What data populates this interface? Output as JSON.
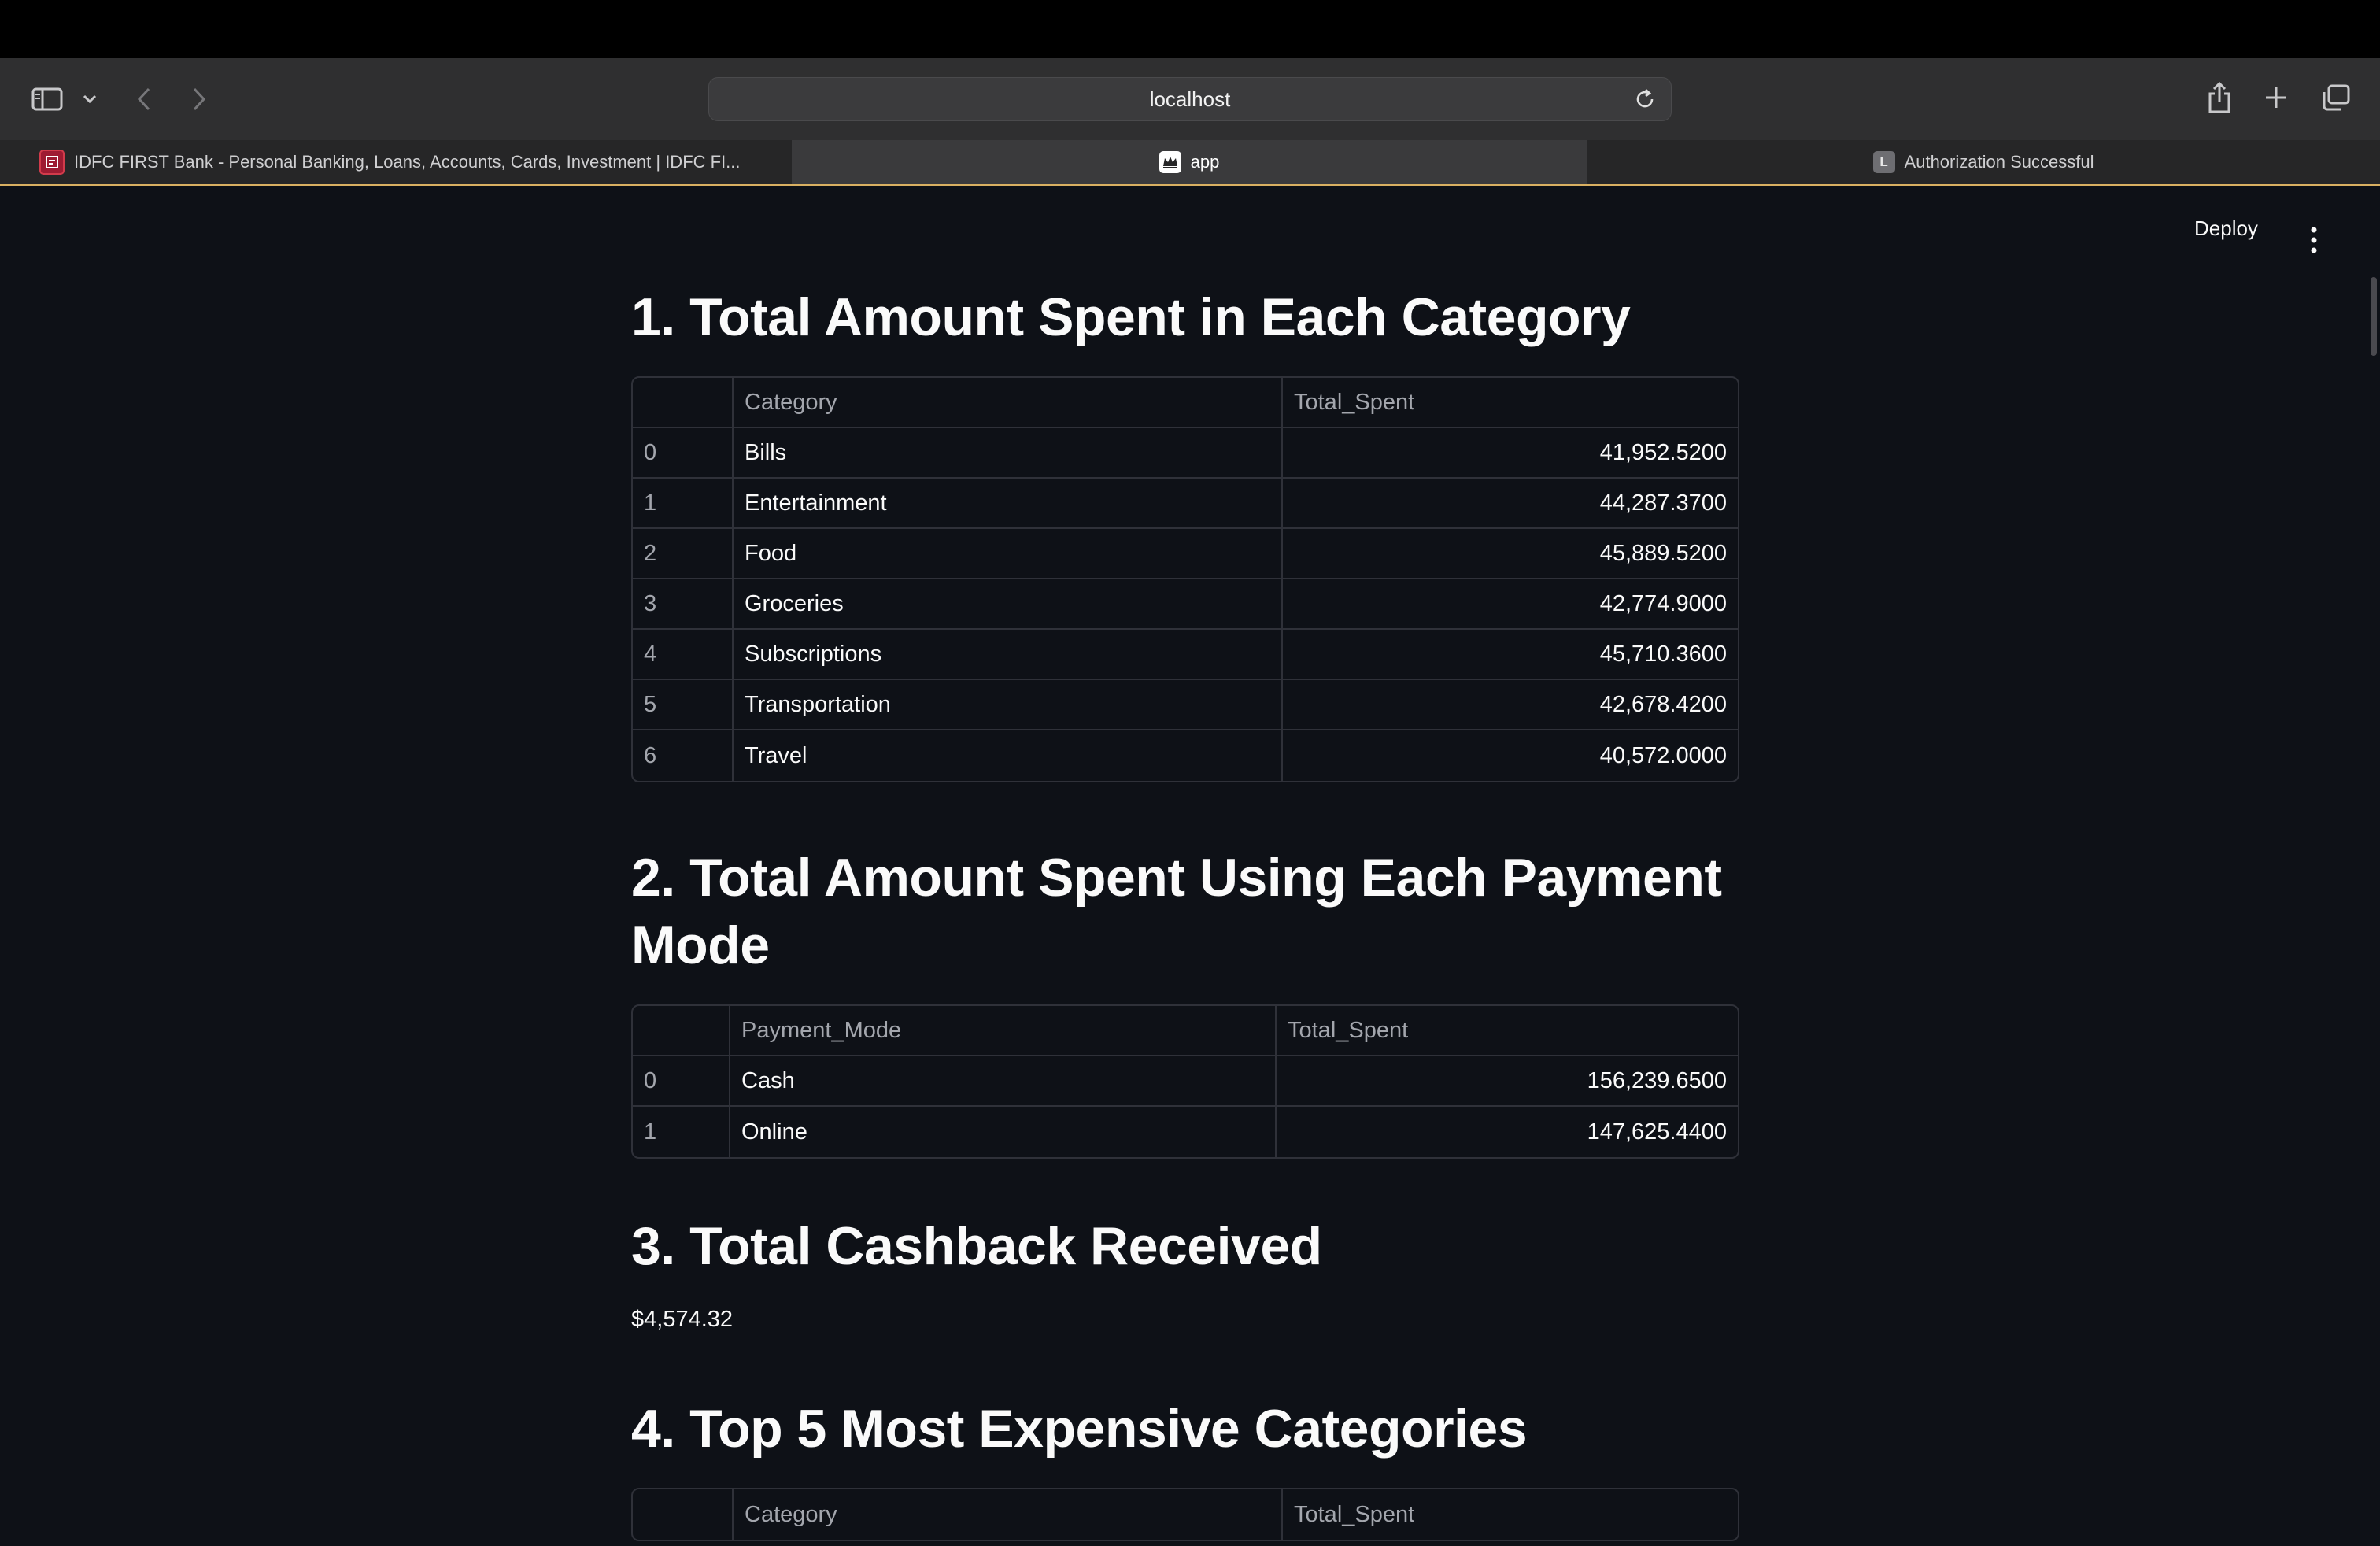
{
  "browser": {
    "url": "localhost",
    "tabs": [
      {
        "label": "IDFC FIRST Bank - Personal Banking, Loans, Accounts, Cards, Investment | IDFC FI...",
        "active": false
      },
      {
        "label": "app",
        "active": true
      },
      {
        "label": "Authorization Successful",
        "active": false
      }
    ],
    "tab3_favicon_letter": "L"
  },
  "header": {
    "deploy_label": "Deploy"
  },
  "sections": {
    "s1": {
      "title": "1. Total Amount Spent in Each Category",
      "columns": [
        "",
        "Category",
        "Total_Spent"
      ],
      "rows": [
        [
          "0",
          "Bills",
          "41,952.5200"
        ],
        [
          "1",
          "Entertainment",
          "44,287.3700"
        ],
        [
          "2",
          "Food",
          "45,889.5200"
        ],
        [
          "3",
          "Groceries",
          "42,774.9000"
        ],
        [
          "4",
          "Subscriptions",
          "45,710.3600"
        ],
        [
          "5",
          "Transportation",
          "42,678.4200"
        ],
        [
          "6",
          "Travel",
          "40,572.0000"
        ]
      ]
    },
    "s2": {
      "title_line1": "2. Total Amount Spent Using Each Payment",
      "title_line2": "Mode",
      "columns": [
        "",
        "Payment_Mode",
        "Total_Spent"
      ],
      "rows": [
        [
          "0",
          "Cash",
          "156,239.6500"
        ],
        [
          "1",
          "Online",
          "147,625.4400"
        ]
      ]
    },
    "s3": {
      "title": "3. Total Cashback Received",
      "value": "$4,574.32"
    },
    "s4": {
      "title": "4. Top 5 Most Expensive Categories",
      "columns": [
        "",
        "Category",
        "Total_Spent"
      ]
    }
  }
}
